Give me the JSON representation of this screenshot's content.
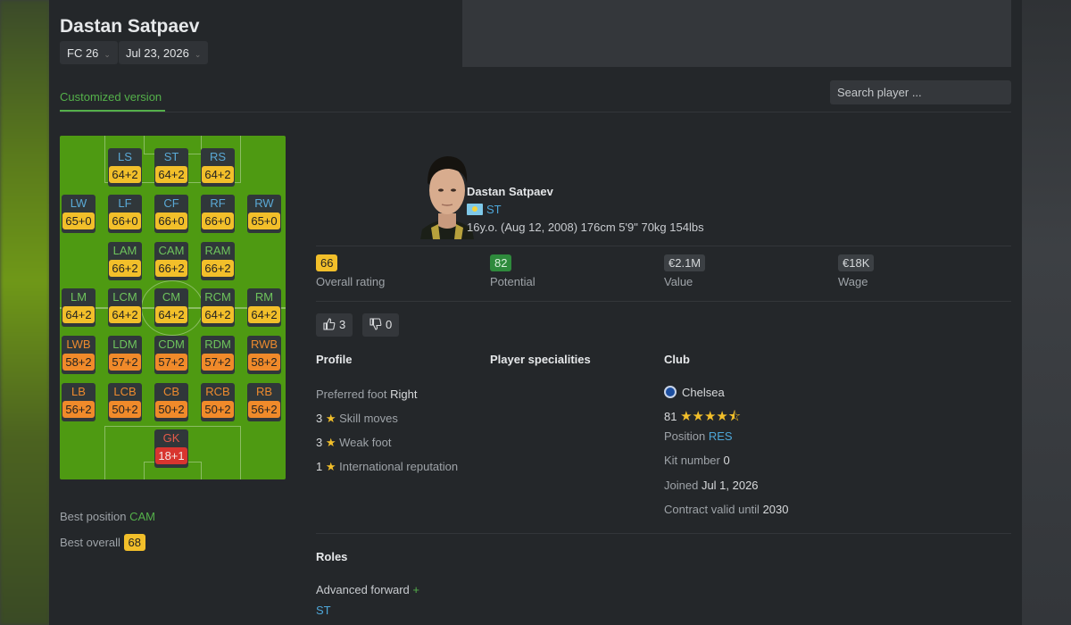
{
  "page": {
    "title": "Dastan Satpaev",
    "game_dropdown": "FC 26",
    "date_dropdown": "Jul 23, 2026",
    "tab_label": "Customized version",
    "search_placeholder": "Search player ..."
  },
  "pitch": {
    "positions": [
      {
        "name": "LS",
        "value": "64+2",
        "color": "yellow",
        "group": "att"
      },
      {
        "name": "ST",
        "value": "64+2",
        "color": "yellow",
        "group": "att"
      },
      {
        "name": "RS",
        "value": "64+2",
        "color": "yellow",
        "group": "att"
      },
      {
        "name": "LW",
        "value": "65+0",
        "color": "yellow",
        "group": "att"
      },
      {
        "name": "LF",
        "value": "66+0",
        "color": "yellow",
        "group": "att"
      },
      {
        "name": "CF",
        "value": "66+0",
        "color": "yellow",
        "group": "att"
      },
      {
        "name": "RF",
        "value": "66+0",
        "color": "yellow",
        "group": "att"
      },
      {
        "name": "RW",
        "value": "65+0",
        "color": "yellow",
        "group": "att"
      },
      {
        "name": "LAM",
        "value": "66+2",
        "color": "yellow",
        "group": "mid"
      },
      {
        "name": "CAM",
        "value": "66+2",
        "color": "yellow",
        "group": "mid"
      },
      {
        "name": "RAM",
        "value": "66+2",
        "color": "yellow",
        "group": "mid"
      },
      {
        "name": "LM",
        "value": "64+2",
        "color": "yellow",
        "group": "mid"
      },
      {
        "name": "LCM",
        "value": "64+2",
        "color": "yellow",
        "group": "mid"
      },
      {
        "name": "CM",
        "value": "64+2",
        "color": "yellow",
        "group": "mid"
      },
      {
        "name": "RCM",
        "value": "64+2",
        "color": "yellow",
        "group": "mid"
      },
      {
        "name": "RM",
        "value": "64+2",
        "color": "yellow",
        "group": "mid"
      },
      {
        "name": "LWB",
        "value": "58+2",
        "color": "orange",
        "group": "def"
      },
      {
        "name": "LDM",
        "value": "57+2",
        "color": "orange",
        "group": "mid"
      },
      {
        "name": "CDM",
        "value": "57+2",
        "color": "orange",
        "group": "mid"
      },
      {
        "name": "RDM",
        "value": "57+2",
        "color": "orange",
        "group": "mid"
      },
      {
        "name": "RWB",
        "value": "58+2",
        "color": "orange",
        "group": "def"
      },
      {
        "name": "LB",
        "value": "56+2",
        "color": "orange",
        "group": "def"
      },
      {
        "name": "LCB",
        "value": "50+2",
        "color": "orange",
        "group": "def"
      },
      {
        "name": "CB",
        "value": "50+2",
        "color": "orange",
        "group": "def"
      },
      {
        "name": "RCB",
        "value": "50+2",
        "color": "orange",
        "group": "def"
      },
      {
        "name": "RB",
        "value": "56+2",
        "color": "orange",
        "group": "def"
      },
      {
        "name": "GK",
        "value": "18+1",
        "color": "red",
        "group": "gk"
      }
    ]
  },
  "best": {
    "position_label": "Best position",
    "position_value": "CAM",
    "overall_label": "Best overall",
    "overall_value": "68"
  },
  "player": {
    "name": "Dastan Satpaev",
    "position": "ST",
    "info": "16y.o. (Aug 12, 2008) 176cm 5'9\" 70kg 154lbs"
  },
  "stats": {
    "overall": {
      "value": "66",
      "label": "Overall rating"
    },
    "potential": {
      "value": "82",
      "label": "Potential"
    },
    "value": {
      "value": "€2.1M",
      "label": "Value"
    },
    "wage": {
      "value": "€18K",
      "label": "Wage"
    }
  },
  "votes": {
    "up": "3",
    "down": "0"
  },
  "profile": {
    "title": "Profile",
    "preferred_foot_label": "Preferred foot",
    "preferred_foot_value": "Right",
    "skill_moves_value": "3",
    "skill_moves_label": "Skill moves",
    "weak_foot_value": "3",
    "weak_foot_label": "Weak foot",
    "intl_rep_value": "1",
    "intl_rep_label": "International reputation"
  },
  "specialities": {
    "title": "Player specialities"
  },
  "club": {
    "title": "Club",
    "name": "Chelsea",
    "rating": "81",
    "stars": "★★★★⯪",
    "position_label": "Position",
    "position_value": "RES",
    "kit_label": "Kit number",
    "kit_value": "0",
    "joined_label": "Joined",
    "joined_value": "Jul 1, 2026",
    "contract_label": "Contract valid until",
    "contract_value": "2030"
  },
  "roles": {
    "title": "Roles",
    "role_name": "Advanced forward",
    "role_plus": "+",
    "role_position": "ST"
  }
}
